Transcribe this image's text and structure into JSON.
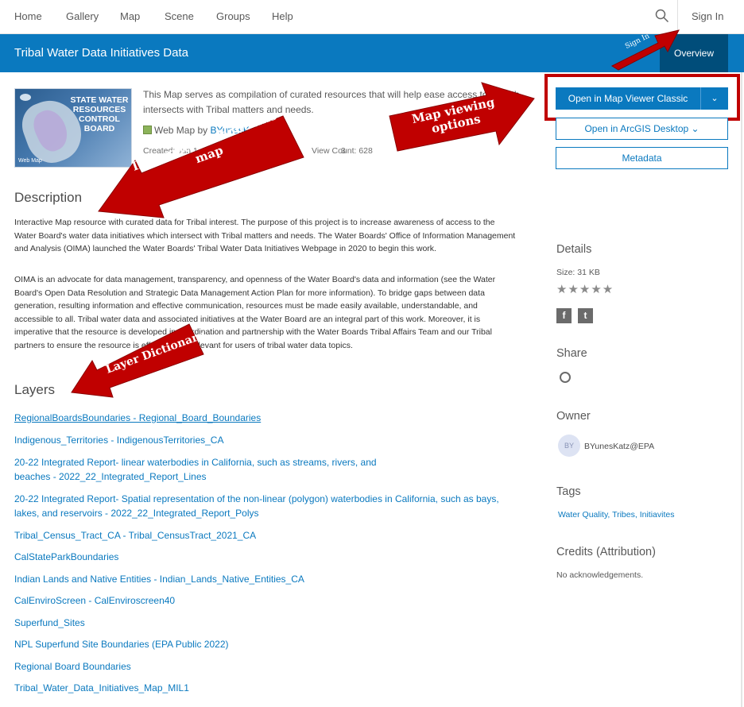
{
  "nav": {
    "items": [
      "Home",
      "Gallery",
      "Map",
      "Scene",
      "Groups",
      "Help"
    ],
    "signin": "Sign In"
  },
  "titlebar": {
    "title": "Tribal Water Data Initiatives Data",
    "overview": "Overview"
  },
  "thumbnail": {
    "title": "STATE WATER RESOURCES CONTROL BOARD",
    "badge": "Web Map"
  },
  "summary": {
    "text": "This Map serves as compilation of curated resources that will help ease access to data th intersects with Tribal matters and needs.",
    "type_label": "Web Map by",
    "owner_link": "BYunesKatz@",
    "created": "Created: Jun 1",
    "created_tail": "3",
    "view_count": "View Count: 628"
  },
  "buttons": {
    "open_viewer": "Open in Map Viewer Classic",
    "dropdown_glyph": "⌄",
    "open_desktop": "Open in ArcGIS Desktop ⌄",
    "metadata": "Metadata"
  },
  "description": {
    "heading": "Description",
    "p1": "Interactive Map resource with curated data for Tribal interest. The purpose of this project is to increase awareness of access to the Water Board's water data initiatives which intersect with Tribal matters and needs. The Water Boards' Office of Information Management and Analysis (OIMA) launched the Water Boards' Tribal Water Data Initiatives Webpage in 2020 to begin this work.",
    "p2": "OIMA is an advocate for data management, transparency, and openness of the Water Board's data and information (see the Water Board's Open Data Resolution and Strategic Data Management Action Plan for more information). To bridge gaps between data generation, resulting information and effective communication, resources must be made easily available, understandable, and accessible to all. Tribal water data and associated initiatives at the Water Board are an integral part of this work. Moreover, it is imperative that the resource is developed in coordination and partnership with the Water Boards Tribal Affairs Team and our Tribal partners to ensure the resource is effective and relevant for users of tribal water data topics."
  },
  "layers": {
    "heading": "Layers",
    "items": [
      "RegionalBoardsBoundaries - Regional_Board_Boundaries",
      "Indigenous_Territories - IndigenousTerritories_CA",
      "20-22 Integrated Report- linear waterbodies in California, such as streams, rivers, and beaches - 2022_22_Integrated_Report_Lines",
      "20-22 Integrated Report- Spatial representation of the non-linear (polygon) waterbodies in California, such as bays, lakes, and reservoirs - 2022_22_Integrated_Report_Polys",
      "Tribal_Census_Tract_CA - Tribal_CensusTract_2021_CA",
      "CalStateParkBoundaries",
      "Indian Lands and Native Entities - Indian_Lands_Native_Entities_CA",
      "CalEnviroScreen - CalEnviroscreen40",
      "Superfund_Sites",
      "NPL Superfund Site Boundaries (EPA Public 2022)",
      "Regional Board Boundaries",
      "Tribal_Water_Data_Initiatives_Map_MIL1"
    ]
  },
  "details": {
    "heading": "Details",
    "size": "Size: 31 KB",
    "stars": "★★★★★",
    "facebook": "f",
    "twitter": "t"
  },
  "share": {
    "heading": "Share"
  },
  "owner": {
    "heading": "Owner",
    "initials": "BY",
    "name": "BYunesKatz@EPA"
  },
  "tags": {
    "heading": "Tags",
    "value": "Water Quality, Tribes, Initiavites"
  },
  "credits": {
    "heading": "Credits (Attribution)",
    "value": "No acknowledgements."
  },
  "annotations": {
    "signin": "Sign In",
    "map_viewing": "Map viewing options",
    "info": "Information about this map",
    "layer_dict": "Layer Dictionary"
  },
  "colors": {
    "accent": "#0a79bf",
    "annotation": "#c00000",
    "overview_bg": "#004d7a"
  }
}
